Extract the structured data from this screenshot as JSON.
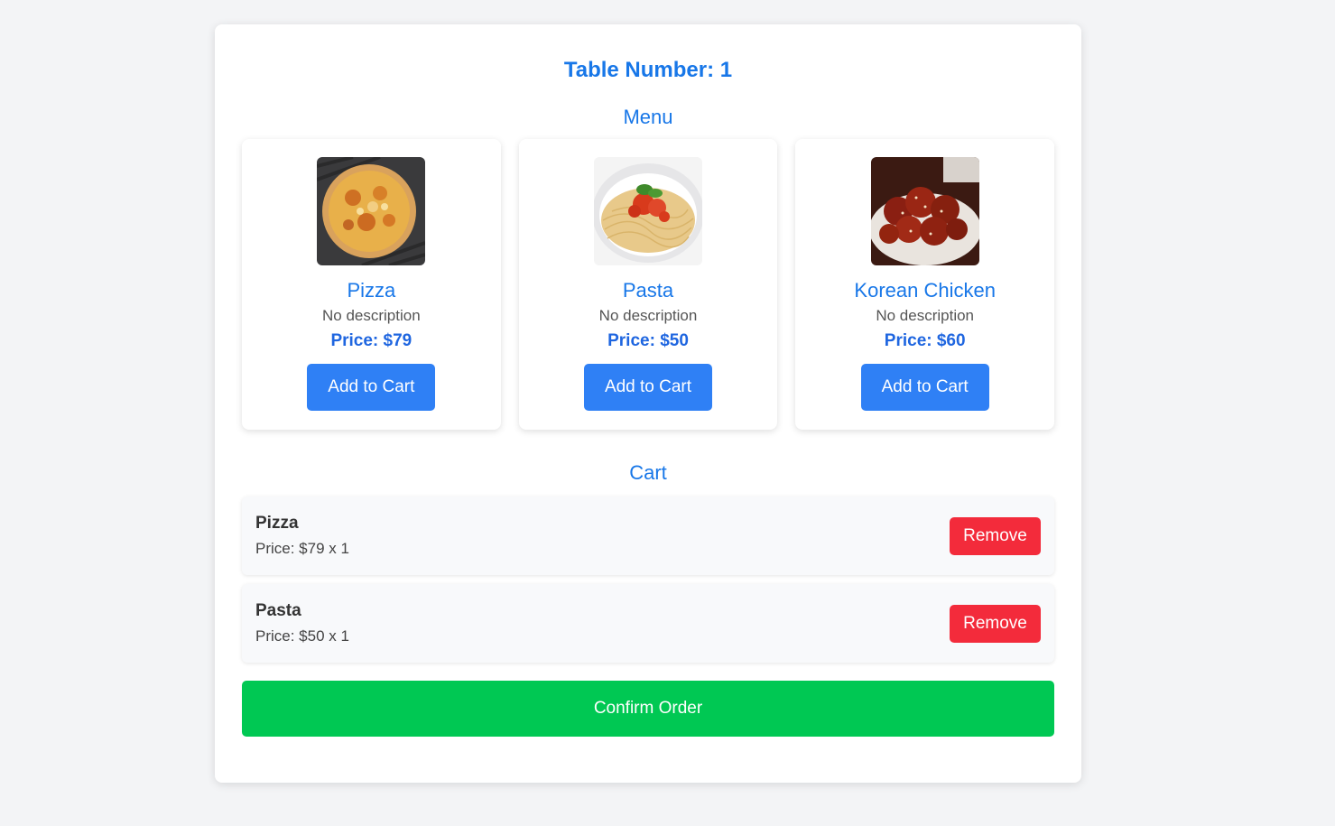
{
  "header": {
    "table_label": "Table Number: 1"
  },
  "menu": {
    "title": "Menu",
    "items": [
      {
        "image": "pizza-image",
        "name": "Pizza",
        "description": "No description",
        "price": "Price: $79",
        "button_label": "Add to Cart"
      },
      {
        "image": "pasta-image",
        "name": "Pasta",
        "description": "No description",
        "price": "Price: $50",
        "button_label": "Add to Cart"
      },
      {
        "image": "korean-chicken-image",
        "name": "Korean Chicken",
        "description": "No description",
        "price": "Price: $60",
        "button_label": "Add to Cart"
      }
    ]
  },
  "cart": {
    "title": "Cart",
    "items": [
      {
        "name": "Pizza",
        "price_qty": "Price: $79 x 1",
        "remove_label": "Remove"
      },
      {
        "name": "Pasta",
        "price_qty": "Price: $50 x 1",
        "remove_label": "Remove"
      }
    ]
  },
  "confirm_label": "Confirm Order",
  "colors": {
    "accent": "#1877e8",
    "add_button": "#2f80f5",
    "remove_button": "#f32b3b",
    "confirm_button": "#00c853",
    "background": "#f3f4f6"
  }
}
